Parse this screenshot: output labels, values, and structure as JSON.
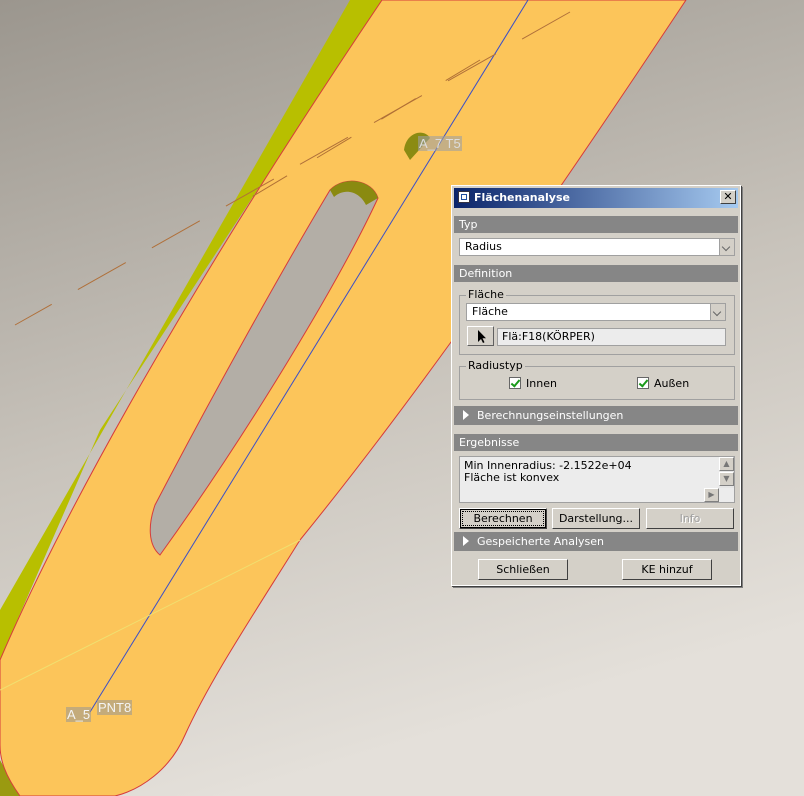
{
  "viewport": {
    "labels": {
      "a5": "A_5",
      "pnt8": "PNT8",
      "a7": "A_7 T5"
    }
  },
  "dialog": {
    "title": "Flächenanalyse",
    "close_glyph": "✕",
    "sections": {
      "typ": "Typ",
      "definition": "Definition",
      "berechnung": "Berechnungseinstellungen",
      "ergebnisse": "Ergebnisse",
      "gespeichert": "Gespeicherte Analysen"
    },
    "typ_select": {
      "value": "Radius"
    },
    "flaeche_group": {
      "label": "Fläche",
      "select_value": "Fläche",
      "selection": "Flä:F18(KÖRPER)"
    },
    "radiustyp_group": {
      "label": "Radiustyp",
      "innen": {
        "label": "Innen",
        "checked": true
      },
      "aussen": {
        "label": "Außen",
        "checked": true
      }
    },
    "results": {
      "line1": "Min Innenradius: -2.1522e+04",
      "line2": "Fläche ist konvex"
    },
    "buttons": {
      "berechnen": "Berechnen",
      "darstellung": "Darstellung...",
      "info": "Info",
      "schliessen": "Schließen",
      "ke_hinzu": "KE hinzuf"
    }
  }
}
